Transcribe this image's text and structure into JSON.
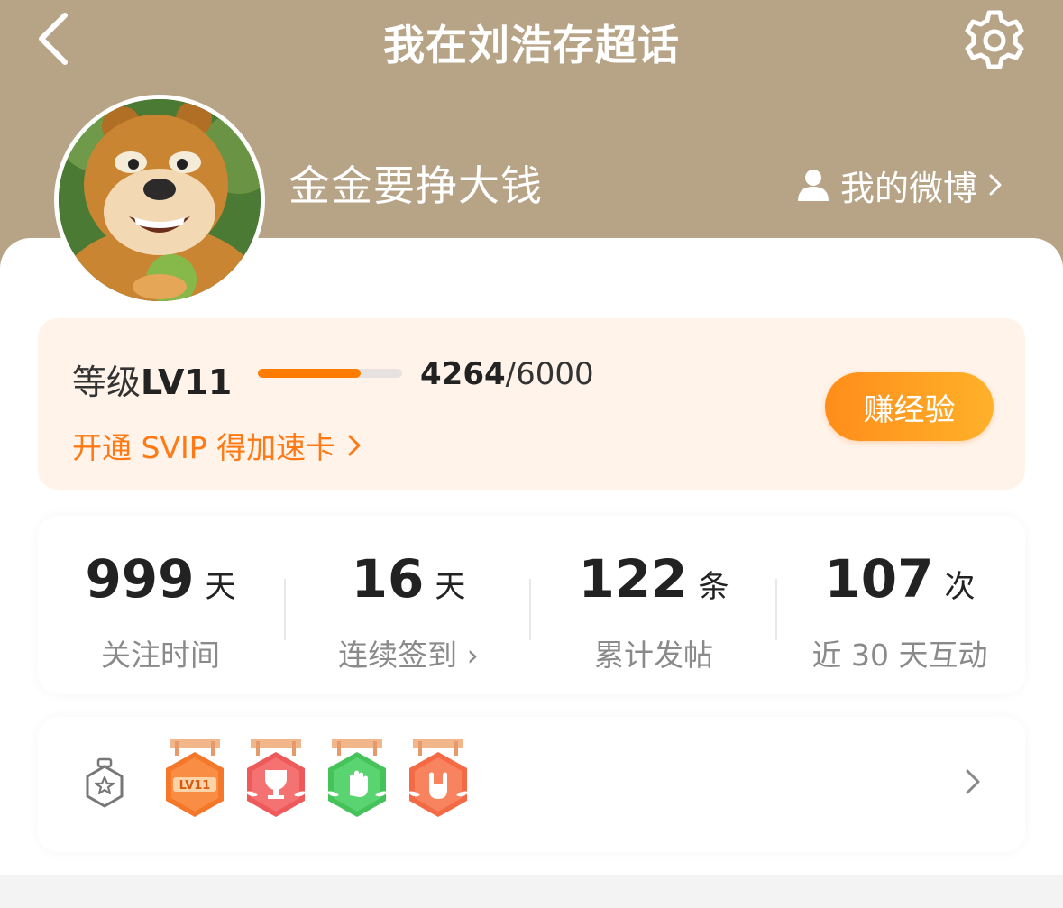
{
  "header": {
    "title": "我在刘浩存超话",
    "back_icon": "chevron-left-icon",
    "settings_icon": "gear-icon",
    "background_color": "#b7a487"
  },
  "profile": {
    "username": "金金要挣大钱",
    "my_weibo_label": "我的微博",
    "avatar_icon": "bear-avatar"
  },
  "level": {
    "label_prefix": "等级",
    "level": "LV11",
    "exp_current": "4264",
    "exp_total": "/6000",
    "progress": 0.71,
    "svip_link": "开通 SVIP 得加速卡",
    "earn_button": "赚经验",
    "accent_color": "#ff7c00"
  },
  "stats": [
    {
      "value": "999",
      "unit": "天",
      "label": "关注时间"
    },
    {
      "value": "16",
      "unit": "天",
      "label": "连续签到 ›"
    },
    {
      "value": "122",
      "unit": "条",
      "label": "累计发帖"
    },
    {
      "value": "107",
      "unit": "次",
      "label": "近 30 天互动"
    }
  ],
  "badges": {
    "items": [
      {
        "icon": "lv11-badge-icon",
        "text": "LV11",
        "color": "#f4772a"
      },
      {
        "icon": "trophy-badge-icon",
        "color": "#ee5a5a"
      },
      {
        "icon": "hand-badge-icon",
        "color": "#45c35a"
      },
      {
        "icon": "rock-hand-badge-icon",
        "color": "#f36a45"
      }
    ]
  }
}
